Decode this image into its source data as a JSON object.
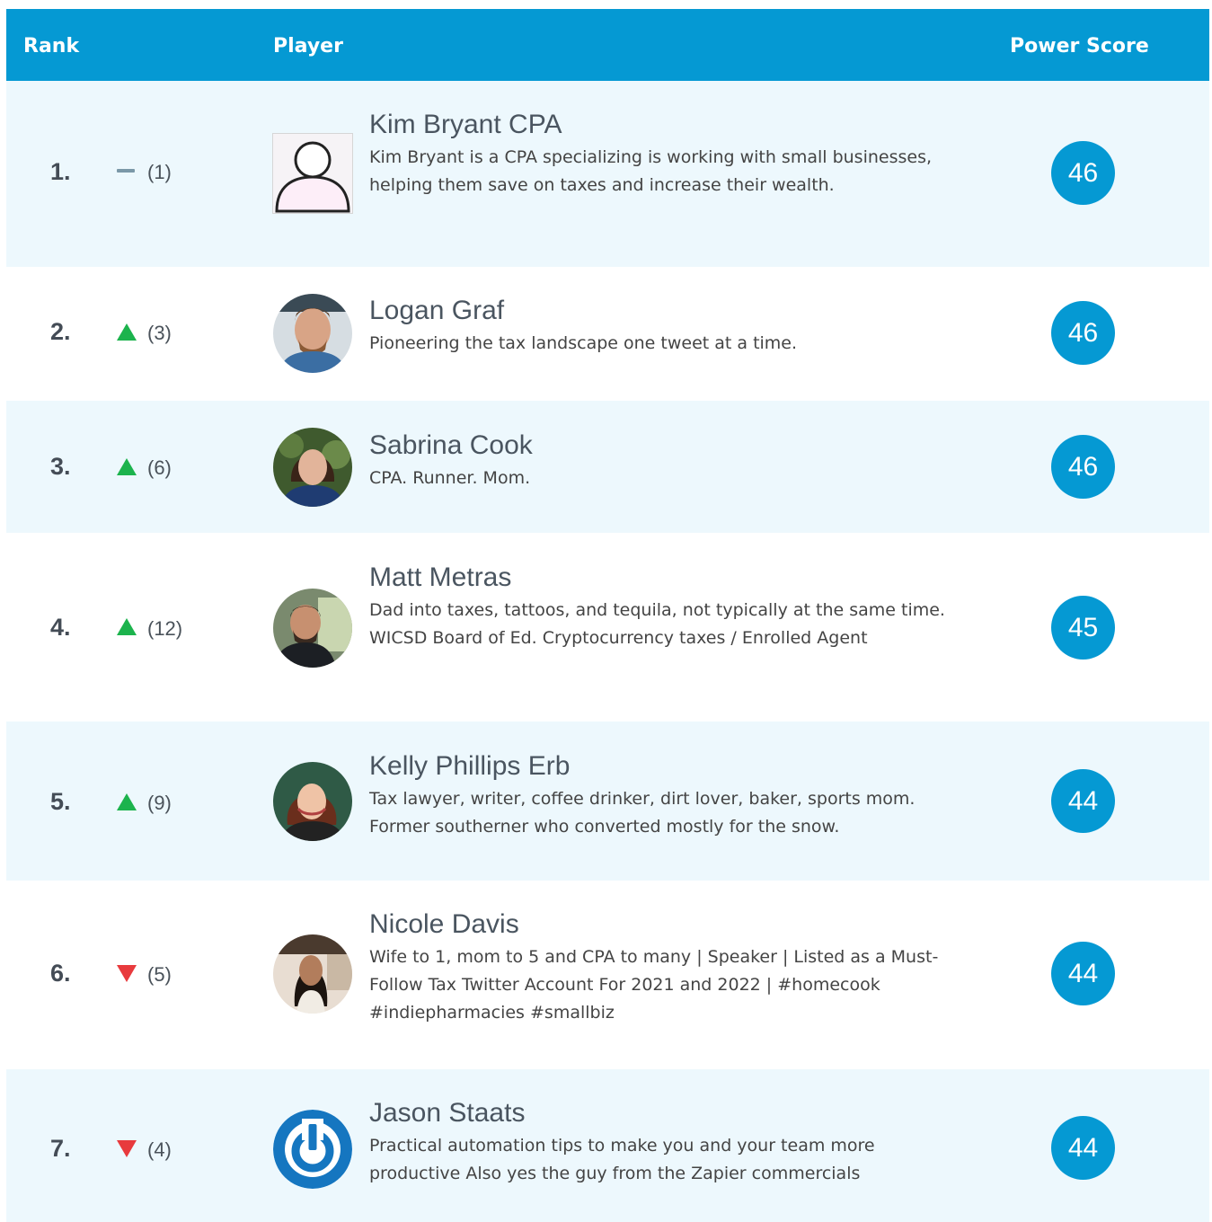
{
  "header": {
    "rank": "Rank",
    "player": "Player",
    "score": "Power Score"
  },
  "colors": {
    "accent": "#0599d3",
    "up": "#1cb34d",
    "down": "#e83a3d",
    "row_alt": "#edf8fd"
  },
  "rows": [
    {
      "rank": "1.",
      "trend": "same",
      "prev": "(1)",
      "name": "Kim Bryant CPA",
      "desc": "Kim Bryant is a CPA specializing is working with small businesses, helping them save on taxes and increase their wealth.",
      "score": "46",
      "avatar": "default-user-icon"
    },
    {
      "rank": "2.",
      "trend": "up",
      "prev": "(3)",
      "name": "Logan Graf",
      "desc": "Pioneering the tax landscape one tweet at a time.",
      "score": "46",
      "avatar": "photo"
    },
    {
      "rank": "3.",
      "trend": "up",
      "prev": "(6)",
      "name": "Sabrina Cook",
      "desc": "CPA. Runner. Mom.",
      "score": "46",
      "avatar": "photo"
    },
    {
      "rank": "4.",
      "trend": "up",
      "prev": "(12)",
      "name": "Matt Metras",
      "desc": "Dad into taxes, tattoos, and tequila, not typically at the same time. WICSD Board of Ed. Cryptocurrency taxes / Enrolled Agent",
      "score": "45",
      "avatar": "photo"
    },
    {
      "rank": "5.",
      "trend": "up",
      "prev": "(9)",
      "name": "Kelly Phillips Erb",
      "desc": "Tax lawyer, writer, coffee drinker, dirt lover, baker, sports mom. Former southerner who converted mostly for the snow.",
      "score": "44",
      "avatar": "photo"
    },
    {
      "rank": "6.",
      "trend": "down",
      "prev": "(5)",
      "name": "Nicole Davis",
      "desc": "Wife to 1, mom to 5 and CPA to many | Speaker | Listed as a Must-Follow Tax Twitter Account For 2021 and 2022 | #homecook #indiepharmacies #smallbiz",
      "score": "44",
      "avatar": "photo"
    },
    {
      "rank": "7.",
      "trend": "down",
      "prev": "(4)",
      "name": "Jason Staats",
      "desc": "Practical automation tips to make you and your team more productive Also yes the guy from the Zapier commercials",
      "score": "44",
      "avatar": "power-logo"
    }
  ]
}
